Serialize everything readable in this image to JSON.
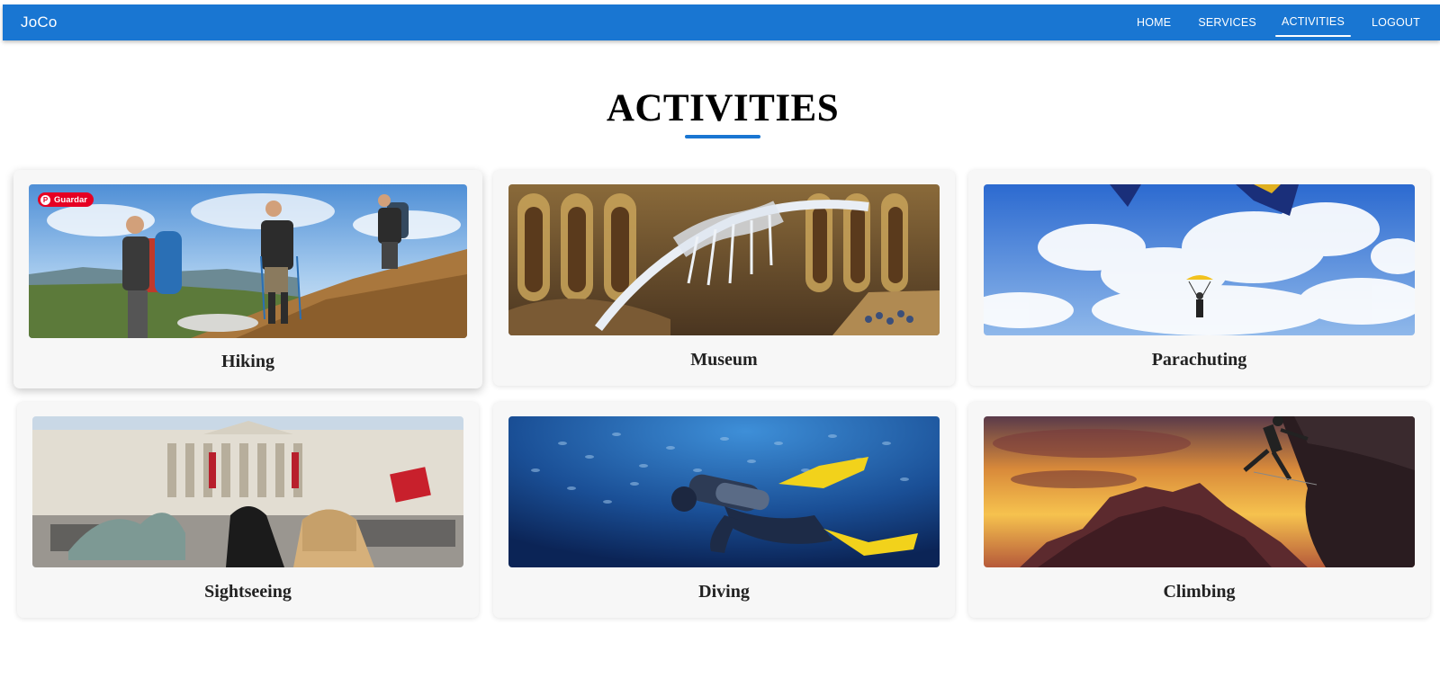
{
  "appbar": {
    "brand": "JoCo",
    "nav": [
      {
        "label": "HOME"
      },
      {
        "label": "SERVICES"
      },
      {
        "label": "ACTIVITIES",
        "active": true
      },
      {
        "label": "LOGOUT"
      }
    ]
  },
  "page": {
    "title": "ACTIVITIES"
  },
  "cards": [
    {
      "label": "Hiking",
      "image_icon": "hiking-photo",
      "pin_label": "Guardar"
    },
    {
      "label": "Museum",
      "image_icon": "museum-photo"
    },
    {
      "label": "Parachuting",
      "image_icon": "parachuting-photo"
    },
    {
      "label": "Sightseeing",
      "image_icon": "sightseeing-photo"
    },
    {
      "label": "Diving",
      "image_icon": "diving-photo"
    },
    {
      "label": "Climbing",
      "image_icon": "climbing-photo"
    }
  ],
  "colors": {
    "primary": "#1976d2",
    "card_bg": "#f7f7f7",
    "pin_red": "#e60023"
  }
}
